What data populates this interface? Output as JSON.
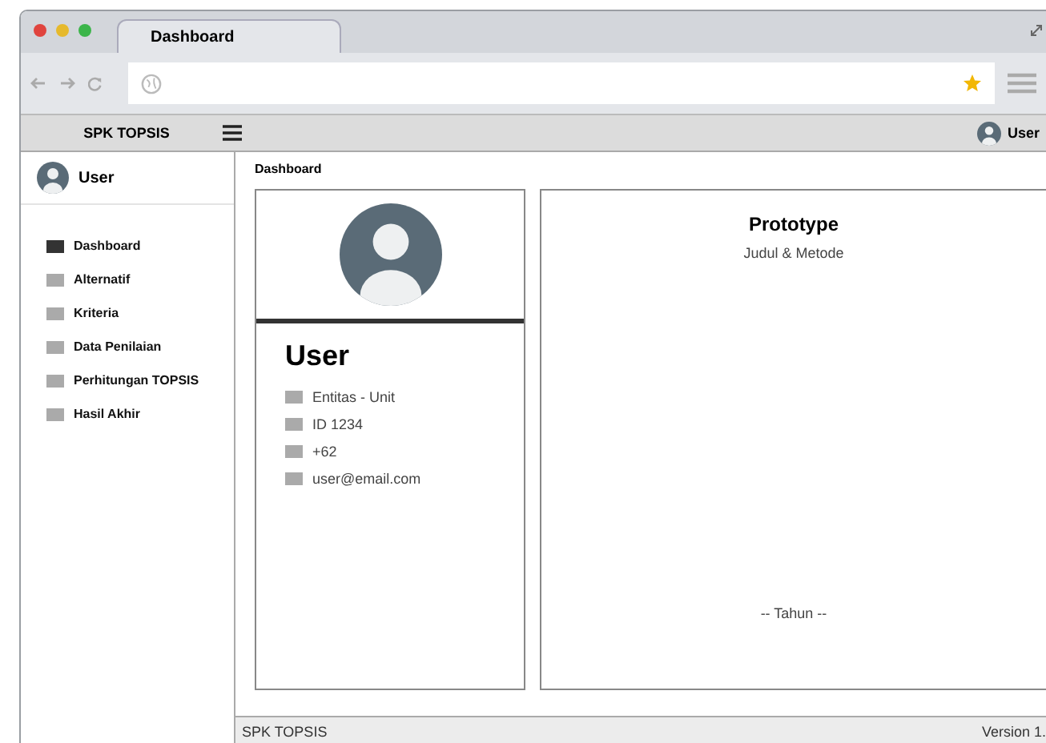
{
  "browser": {
    "tab": "Dashboard"
  },
  "app_header": {
    "brand": "SPK TOPSIS",
    "user": "User"
  },
  "sidebar": {
    "user": "User",
    "items": [
      {
        "label": "Dashboard",
        "selected": true
      },
      {
        "label": "Alternatif",
        "selected": false
      },
      {
        "label": "Kriteria",
        "selected": false
      },
      {
        "label": "Data Penilaian",
        "selected": false
      },
      {
        "label": "Perhitungan TOPSIS",
        "selected": false
      },
      {
        "label": "Hasil Akhir",
        "selected": false
      }
    ]
  },
  "breadcrumb": "Dashboard",
  "profile": {
    "name": "User",
    "details": [
      "Entitas - Unit",
      "ID 1234",
      "+62",
      "user@email.com"
    ]
  },
  "info": {
    "title": "Prototype",
    "subtitle": "Judul & Metode",
    "year": "-- Tahun --"
  },
  "footer": {
    "left": "SPK TOPSIS",
    "right": "Version 1."
  }
}
